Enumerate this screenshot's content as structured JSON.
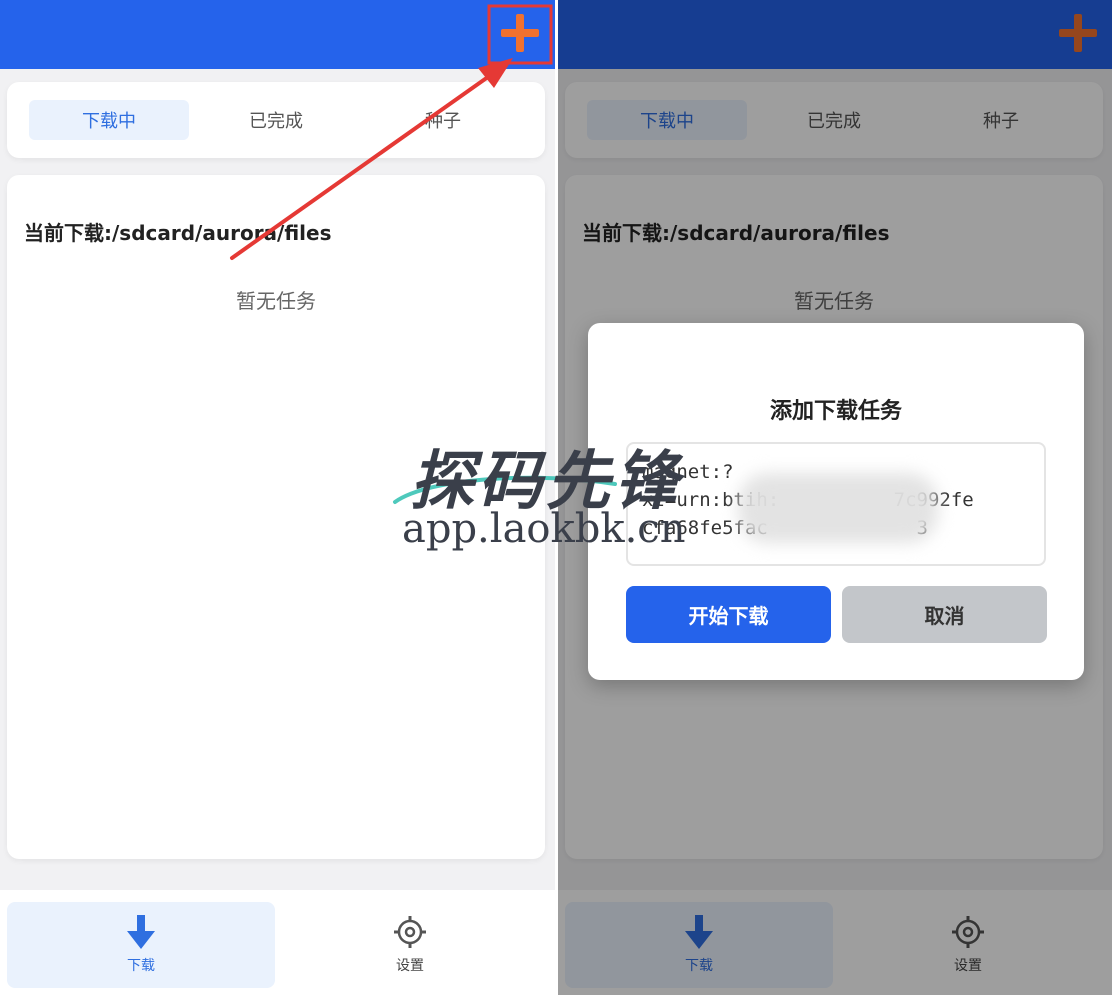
{
  "screens": {
    "left": {
      "tabs": [
        {
          "label": "下载中",
          "active": true
        },
        {
          "label": "已完成",
          "active": false
        },
        {
          "label": "种子",
          "active": false
        }
      ],
      "path_label": "当前下载:/sdcard/aurora/files",
      "empty_text": "暂无任务",
      "nav": {
        "download_label": "下载",
        "settings_label": "设置"
      }
    },
    "right": {
      "tabs": [
        {
          "label": "下载中",
          "active": true
        },
        {
          "label": "已完成",
          "active": false
        },
        {
          "label": "种子",
          "active": false
        }
      ],
      "path_label": "当前下载:/sdcard/aurora/files",
      "empty_text": "暂无任务",
      "nav": {
        "download_label": "下载",
        "settings_label": "设置"
      },
      "dialog": {
        "title": "添加下载任务",
        "link_value": "magnet:?\nxt=urn:btih:          7c992fe\ncfa68fe5fac             3",
        "start_label": "开始下载",
        "cancel_label": "取消"
      }
    }
  },
  "icons": {
    "add": "plus-icon",
    "download": "download-arrow-icon",
    "settings": "gear-icon"
  },
  "colors": {
    "primary": "#2563eb",
    "accent_plus": "#f0712f",
    "annotation": "#e53935",
    "tab_active_bg": "#eaf2fd"
  },
  "watermark": {
    "brand": "探码先锋",
    "url": "app.laokbk.cn"
  }
}
